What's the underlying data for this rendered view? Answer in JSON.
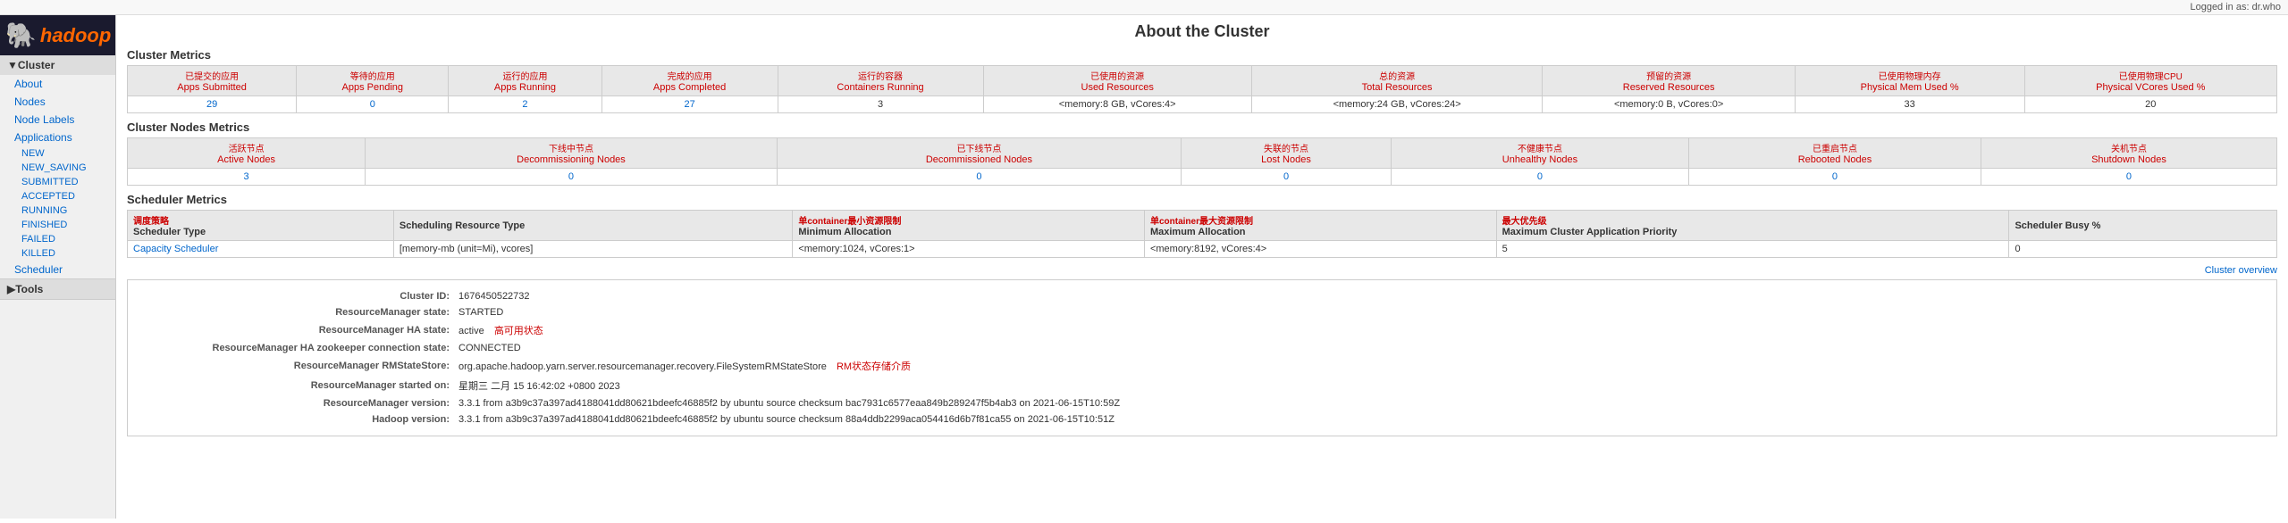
{
  "topbar": {
    "logged_in": "Logged in as: dr.who"
  },
  "sidebar": {
    "cluster_label": "Cluster",
    "about_label": "About",
    "nodes_label": "Nodes",
    "node_labels_label": "Node Labels",
    "applications_label": "Applications",
    "new_label": "NEW",
    "new_saving_label": "NEW_SAVING",
    "submitted_label": "SUBMITTED",
    "accepted_label": "ACCEPTED",
    "running_label": "RUNNING",
    "finished_label": "FINISHED",
    "failed_label": "FAILED",
    "killed_label": "KILLED",
    "scheduler_label": "Scheduler",
    "tools_label": "Tools"
  },
  "page": {
    "title": "About the Cluster"
  },
  "cluster_metrics": {
    "section_title": "Cluster Metrics",
    "headers": {
      "apps_submitted": "Apps Submitted",
      "apps_pending": "Apps Pending",
      "apps_running": "Apps Running",
      "apps_completed": "Apps Completed",
      "containers_running": "Containers Running",
      "used_resources": "Used Resources",
      "total_resources": "Total Resources",
      "reserved_resources": "Reserved Resources",
      "physical_mem_used": "Physical Mem Used %",
      "physical_vcores_used": "Physical VCores Used %"
    },
    "values": {
      "apps_submitted": "29",
      "apps_pending": "0",
      "apps_running": "2",
      "apps_completed": "27",
      "containers_running": "3",
      "used_resources": "<memory:8 GB, vCores:4>",
      "total_resources": "<memory:24 GB, vCores:24>",
      "reserved_resources": "<memory:0 B, vCores:0>",
      "physical_mem_used": "33",
      "physical_vcores_used": "20"
    },
    "annotations": {
      "apps_submitted_cn": "已提交的应用",
      "apps_pending_cn": "等待的应用",
      "apps_running_cn": "运行的应用",
      "apps_completed_cn": "完成的应用",
      "containers_running_cn": "运行的容器",
      "used_resources_cn": "已使用的资源",
      "total_resources_cn": "总的资源",
      "reserved_resources_cn": "预留的资源",
      "physical_mem_cn": "已使用物理内存",
      "physical_vcores_cn": "已使用物理CPU"
    }
  },
  "cluster_nodes_metrics": {
    "section_title": "Cluster Nodes Metrics",
    "headers": {
      "active_nodes": "Active Nodes",
      "decommissioning_nodes": "Decommissioning Nodes",
      "decommissioned_nodes": "Decommissioned Nodes",
      "lost_nodes": "Lost Nodes",
      "unhealthy_nodes": "Unhealthy Nodes",
      "rebooted_nodes": "Rebooted Nodes",
      "shutdown_nodes": "Shutdown Nodes"
    },
    "values": {
      "active_nodes": "3",
      "decommissioning_nodes": "0",
      "decommissioned_nodes": "0",
      "lost_nodes": "0",
      "unhealthy_nodes": "0",
      "rebooted_nodes": "0",
      "shutdown_nodes": "0"
    },
    "annotations": {
      "active_nodes_cn": "活跃节点",
      "decommissioning_cn": "下线中节点",
      "decommissioned_cn": "已下线节点",
      "lost_cn": "失联的节点",
      "unhealthy_cn": "不健康节点",
      "rebooted_cn": "已重启节点",
      "shutdown_cn": "关机节点"
    }
  },
  "scheduler_metrics": {
    "section_title": "Scheduler Metrics",
    "headers": {
      "scheduler_type": "Scheduler Type",
      "scheduling_resource_type": "Scheduling Resource Type",
      "minimum_allocation": "Minimum Allocation",
      "maximum_allocation": "Maximum Allocation",
      "max_cluster_app_priority": "Maximum Cluster Application Priority",
      "scheduler_busy": "Scheduler Busy %"
    },
    "values": {
      "scheduler_type": "Capacity Scheduler",
      "scheduling_resource_type": "[memory-mb (unit=Mi), vcores]",
      "minimum_allocation": "<memory:1024, vCores:1>",
      "maximum_allocation": "<memory:8192, vCores:4>",
      "max_cluster_app_priority": "5",
      "scheduler_busy": "0"
    },
    "annotations": {
      "scheduler_type_cn": "调度策略",
      "min_allocation_cn": "单container最小资源限制",
      "max_allocation_cn": "单container最大资源限制",
      "max_priority_cn": "最大优先级"
    }
  },
  "cluster_overview": {
    "link_text": "Cluster overview"
  },
  "cluster_info": {
    "cluster_id_label": "Cluster ID:",
    "cluster_id_value": "1676450522732",
    "rm_state_label": "ResourceManager state:",
    "rm_state_value": "STARTED",
    "rm_ha_state_label": "ResourceManager HA state:",
    "rm_ha_state_value": "active",
    "rm_ha_state_annotation": "高可用状态",
    "rm_zk_label": "ResourceManager HA zookeeper connection state:",
    "rm_zk_value": "CONNECTED",
    "rm_rmstate_label": "ResourceManager RMStateStore:",
    "rm_rmstate_value": "org.apache.hadoop.yarn.server.resourcemanager.recovery.FileSystemRMStateStore",
    "rm_rmstate_annotation": "RM状态存储介质",
    "rm_started_label": "ResourceManager started on:",
    "rm_started_value": "星期三 二月 15 16:42:02 +0800 2023",
    "rm_version_label": "ResourceManager version:",
    "rm_version_value": "3.3.1 from a3b9c37a397ad4188041dd80621bdeefc46885f2 by ubuntu source checksum bac7931c6577eaa849b289247f5b4ab3 on 2021-06-15T10:59Z",
    "hadoop_version_label": "Hadoop version:",
    "hadoop_version_value": "3.3.1 from a3b9c37a397ad4188041dd80621bdeefc46885f2 by ubuntu source checksum 88a4ddb2299aca054416d6b7f81ca55 on 2021-06-15T10:51Z"
  }
}
